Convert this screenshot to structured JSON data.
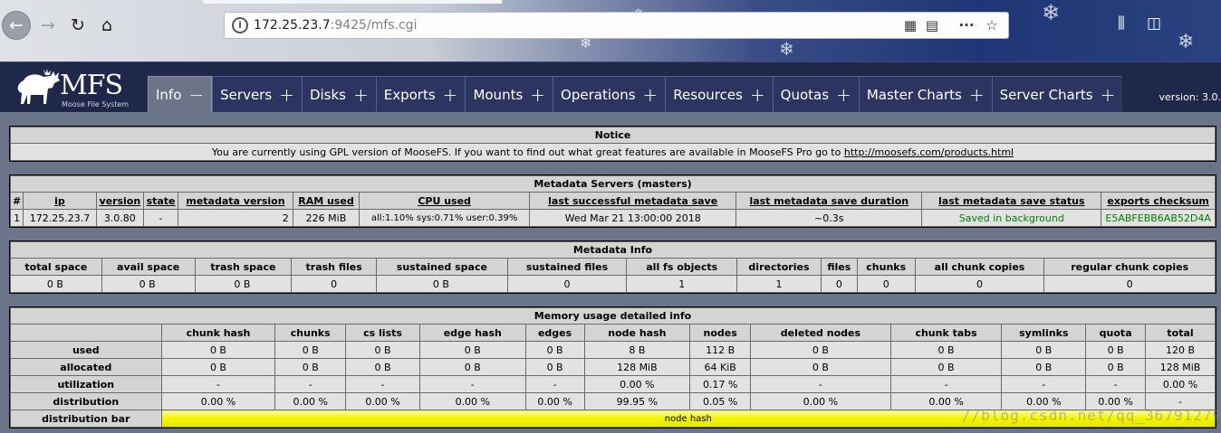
{
  "browser": {
    "url_host": "172.25.23.7",
    "url_rest": ":9425/mfs.cgi",
    "back_icon": "arrow-left-icon",
    "forward_icon": "arrow-right-icon",
    "reload_icon": "reload-icon",
    "home_icon": "home-icon"
  },
  "header": {
    "logo_text": "MFS",
    "logo_sub": "Moose File System",
    "version": "version: 3.0.",
    "tabs": [
      {
        "label": "Info",
        "sign": "−",
        "active": true
      },
      {
        "label": "Servers",
        "sign": "+"
      },
      {
        "label": "Disks",
        "sign": "+"
      },
      {
        "label": "Exports",
        "sign": "+"
      },
      {
        "label": "Mounts",
        "sign": "+"
      },
      {
        "label": "Operations",
        "sign": "+"
      },
      {
        "label": "Resources",
        "sign": "+"
      },
      {
        "label": "Quotas",
        "sign": "+"
      },
      {
        "label": "Master Charts",
        "sign": "+"
      },
      {
        "label": "Server Charts",
        "sign": "+"
      }
    ]
  },
  "notice": {
    "title": "Notice",
    "text": "You are currently using GPL version of MooseFS. If you want to find out what great features are available in MooseFS Pro go to",
    "link": "http://moosefs.com/products.html"
  },
  "metadata_servers": {
    "title": "Metadata Servers (masters)",
    "columns": [
      "#",
      "ip",
      "version",
      "state",
      "metadata version",
      "RAM used",
      "CPU used",
      "last successful metadata save",
      "last metadata save duration",
      "last metadata save status",
      "exports checksum"
    ],
    "row": [
      "1",
      "172.25.23.7",
      "3.0.80",
      "-",
      "2",
      "226 MiB",
      "all:1.10% sys:0.71% user:0.39%",
      "Wed Mar 21 13:00:00 2018",
      "~0.3s",
      "Saved in background",
      "E5ABFEBB6AB52D4A"
    ],
    "status_color": "#008000"
  },
  "metadata_info": {
    "title": "Metadata Info",
    "columns": [
      "total space",
      "avail space",
      "trash space",
      "trash files",
      "sustained space",
      "sustained files",
      "all fs objects",
      "directories",
      "files",
      "chunks",
      "all chunk copies",
      "regular chunk copies"
    ],
    "row": [
      "0 B",
      "0 B",
      "0 B",
      "0",
      "0 B",
      "0",
      "1",
      "1",
      "0",
      "0",
      "0",
      "0"
    ]
  },
  "memory": {
    "title": "Memory usage detailed info",
    "columns": [
      "",
      "chunk hash",
      "chunks",
      "cs lists",
      "edge hash",
      "edges",
      "node hash",
      "nodes",
      "deleted nodes",
      "chunk tabs",
      "symlinks",
      "quota",
      "total"
    ],
    "rows": [
      [
        "used",
        "0 B",
        "0 B",
        "0 B",
        "0 B",
        "0 B",
        "8 B",
        "112 B",
        "0 B",
        "0 B",
        "0 B",
        "0 B",
        "120 B"
      ],
      [
        "allocated",
        "0 B",
        "0 B",
        "0 B",
        "0 B",
        "0 B",
        "128 MiB",
        "64 KiB",
        "0 B",
        "0 B",
        "0 B",
        "0 B",
        "128 MiB"
      ],
      [
        "utilization",
        "-",
        "-",
        "-",
        "-",
        "-",
        "0.00 %",
        "0.17 %",
        "-",
        "-",
        "-",
        "-",
        "0.00 %"
      ],
      [
        "distribution",
        "0.00 %",
        "0.00 %",
        "0.00 %",
        "0.00 %",
        "0.00 %",
        "99.95 %",
        "0.05 %",
        "0.00 %",
        "0.00 %",
        "0.00 %",
        "0.00 %",
        "-"
      ]
    ],
    "bar_label": "distribution bar",
    "bar_text": "node hash",
    "bar_color": "#f4f400"
  },
  "watermark": "//blog.csdn.net/qq_36791279"
}
